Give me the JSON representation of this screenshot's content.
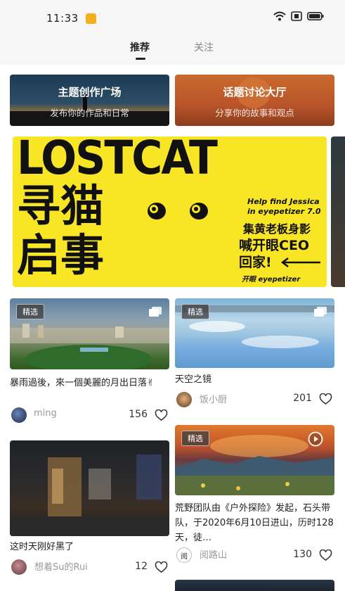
{
  "status": {
    "time": "11:33"
  },
  "tabs": [
    {
      "label": "推荐"
    },
    {
      "label": "关注"
    }
  ],
  "categories": [
    {
      "title": "主题创作广场",
      "subtitle": "发布你的作品和日常"
    },
    {
      "title": "话题讨论大厅",
      "subtitle": "分享你的故事和观点"
    }
  ],
  "poster": {
    "headline": "LOSTCAT",
    "vertical_text": "寻猫启事",
    "line1": "Help find Jessica",
    "line2": "in eyepetizer 7.0",
    "line3": "集黄老板身影",
    "line4": "喊开眼CEO",
    "line5": "回家!",
    "footer": "开眼 eyepetizer"
  },
  "feed": [
    {
      "badge": "精选",
      "title": "暴雨過後，來一個美麗的月出日落✌",
      "author": "ming",
      "likes": "156"
    },
    {
      "badge": "精选",
      "title": "天空之镜",
      "author": "饭小厨",
      "likes": "201"
    },
    {
      "title": "这时天刚好黑了",
      "author": "想着Su的Rui",
      "likes": "12"
    },
    {
      "badge": "精选",
      "title": "荒野团队由《户外探险》发起，石头带队，于2020年6月10日进山，历时128天，徒…",
      "author": "阅路山",
      "avatar_text": "阅",
      "likes": "130"
    }
  ]
}
